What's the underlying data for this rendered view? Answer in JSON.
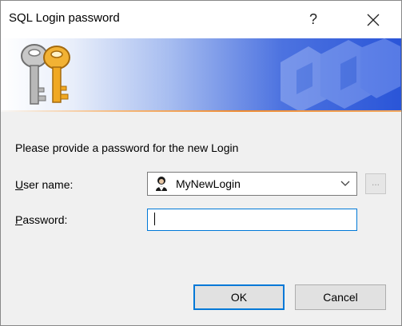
{
  "window": {
    "title": "SQL Login password",
    "help_label": "?",
    "close_icon": "close-icon"
  },
  "banner": {
    "icon": "keys-icon",
    "watermark_icon": "db-watermark-icon"
  },
  "form": {
    "prompt": "Please provide a password for the new Login",
    "username": {
      "label_accel": "U",
      "label_rest": "ser name:",
      "value": "MyNewLogin",
      "icon": "user-icon",
      "browse_label": "..."
    },
    "password": {
      "label_accel": "P",
      "label_rest": "assword:",
      "value": ""
    }
  },
  "buttons": {
    "ok": "OK",
    "cancel": "Cancel"
  },
  "colors": {
    "accent": "#0078d7",
    "banner_start": "#ffffff",
    "banner_end": "#2a55d8",
    "banner_stripe": "#ee8a30"
  }
}
